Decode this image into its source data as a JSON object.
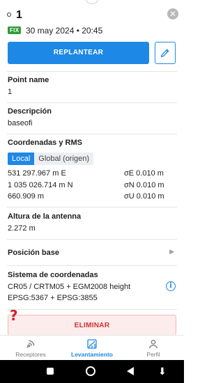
{
  "header": {
    "title": "1",
    "fix_badge": "FIX",
    "datetime": "30 may 2024 • 20:45"
  },
  "actions": {
    "replantear_label": "REPLANTEAR",
    "delete_label": "ELIMINAR"
  },
  "point_name": {
    "label": "Point name",
    "value": "1"
  },
  "descripcion": {
    "label": "Descripción",
    "value": "baseofi"
  },
  "coordenadas": {
    "label": "Coordenadas y RMS",
    "tabs": [
      "Local",
      "Global (origen)"
    ],
    "rows": [
      {
        "value": "531 297.967 m E",
        "rms": "σE 0.010 m"
      },
      {
        "value": "1 035 026.714 m N",
        "rms": "σN 0.010 m"
      },
      {
        "value": "660.909 m",
        "rms": "σU 0.010 m"
      }
    ]
  },
  "altura_antena": {
    "label": "Altura de la antenna",
    "value": "2.272 m"
  },
  "posicion_base": {
    "label": "Posición base"
  },
  "sistema": {
    "label": "Sistema de coordenadas",
    "line1": "CR05 / CRTM05 + EGM2008 height",
    "line2": "EPSG:5367 + EPSG:3855"
  },
  "bottom_nav": [
    {
      "label": "Receptores",
      "icon": "receptor-icon",
      "active": false
    },
    {
      "label": "Levantamiento",
      "icon": "survey-icon",
      "active": true
    },
    {
      "label": "Perfil",
      "icon": "person-icon",
      "active": false
    }
  ],
  "colors": {
    "accent": "#1e88e5",
    "fix_green": "#2e9b3a",
    "danger": "#d32f2f"
  }
}
